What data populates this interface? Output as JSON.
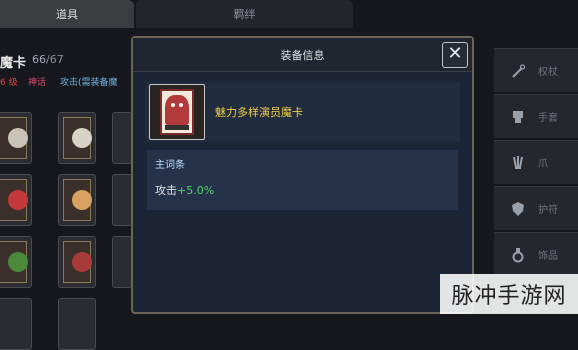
{
  "tabs": {
    "props": "道具",
    "bond": "羁绊"
  },
  "inventory": {
    "title_partial": "魔卡",
    "count": "66",
    "count_max": "/67",
    "level": "6 级",
    "rarity": "神话",
    "attr_partial": "攻击(需装备魔"
  },
  "modal": {
    "title": "装备信息",
    "close_symbol": "✕",
    "item_name": "魅力多样演员魔卡",
    "stat_title": "主词条",
    "stat_label": "攻击",
    "stat_value": "+5.0%"
  },
  "sidebar": {
    "items": [
      {
        "label": "权杖",
        "icon": "wand-icon"
      },
      {
        "label": "手套",
        "icon": "glove-icon"
      },
      {
        "label": "爪",
        "icon": "claw-icon"
      },
      {
        "label": "护符",
        "icon": "shield-icon"
      },
      {
        "label": "饰品",
        "icon": "ring-icon"
      }
    ]
  },
  "watermark": "脉冲手游网",
  "colors": {
    "item_name": "#f0cf4a",
    "stat_positive": "#4fd36a",
    "level_red": "#e2453c",
    "attr_blue": "#6fb0e0"
  }
}
